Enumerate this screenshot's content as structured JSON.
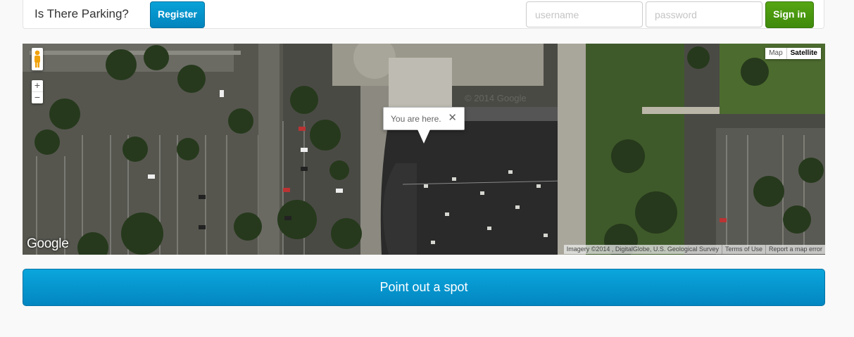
{
  "navbar": {
    "brand": "Is There Parking?",
    "register_label": "Register",
    "username_placeholder": "username",
    "password_placeholder": "password",
    "signin_label": "Sign in"
  },
  "map": {
    "zoom_in": "+",
    "zoom_out": "−",
    "maptype_map": "Map",
    "maptype_satellite": "Satellite",
    "selected_maptype": "Satellite",
    "infowindow_text": "You are here.",
    "infowindow_close": "✕",
    "logo_text": "Google",
    "watermark_text": "© 2014 Google",
    "attribution": "Imagery ©2014 , DigitalGlobe, U.S. Geological Survey",
    "terms": "Terms of Use",
    "report": "Report a map error"
  },
  "actions": {
    "point_out_label": "Point out a spot"
  },
  "icons": {
    "pegman": "pegman-icon",
    "close": "close-icon"
  },
  "colors": {
    "primary": "#0384bd",
    "success": "#3f8a0b",
    "page_bg": "#f9f9f9"
  }
}
